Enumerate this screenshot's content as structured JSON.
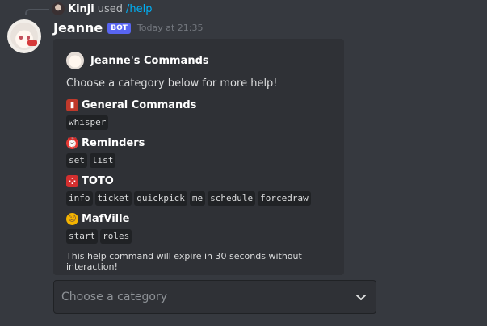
{
  "reply": {
    "user": "Kinji",
    "used": "used",
    "command": "/help"
  },
  "message": {
    "username": "Jeanne",
    "bot_tag": "BOT",
    "timestamp": "Today at 21:35"
  },
  "embed": {
    "author": "Jeanne's Commands",
    "description": "Choose a category below for more help!",
    "fields": [
      {
        "emoji": "closed-book",
        "title": "General Commands",
        "commands": [
          "whisper"
        ]
      },
      {
        "emoji": "alarm-clock",
        "title": "Reminders",
        "commands": [
          "set",
          "list"
        ]
      },
      {
        "emoji": "game-die",
        "title": "TOTO",
        "commands": [
          "info",
          "ticket",
          "quickpick",
          "me",
          "schedule",
          "forcedraw"
        ]
      },
      {
        "emoji": "cowboy-face",
        "title": "MafVille",
        "commands": [
          "start",
          "roles"
        ]
      }
    ],
    "footer": "This help command will expire in 30 seconds without interaction!"
  },
  "select_menu": {
    "placeholder": "Choose a category"
  },
  "colors": {
    "background": "#36393f",
    "embed": "#2f3136",
    "bot_tag": "#5865f2",
    "link": "#00aff4"
  }
}
